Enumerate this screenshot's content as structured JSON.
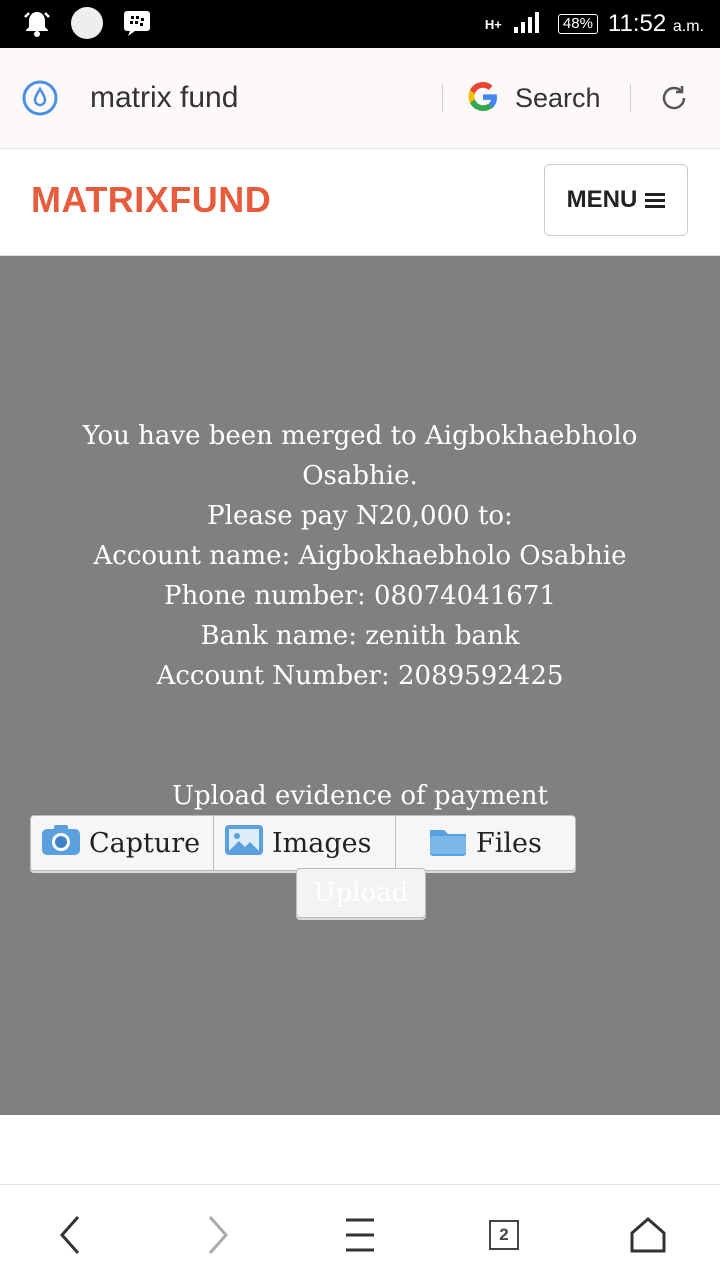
{
  "status_bar": {
    "network": "H+",
    "battery": "48%",
    "time": "11:52",
    "ampm": "a.m."
  },
  "browser": {
    "url_text": "matrix fund",
    "search_label": "Search"
  },
  "site": {
    "brand": "MATRIXFUND",
    "menu_label": "MENU",
    "brand_color": "#e65c3c"
  },
  "modal": {
    "lines": [
      "You have been merged to Aigbokhaebholo Osabhie.",
      "Please pay N20,000 to:",
      "Account name: Aigbokhaebholo Osabhie",
      "Phone number: 08074041671",
      "Bank name: zenith bank",
      "Account Number: 2089592425"
    ],
    "upload_label": "Upload evidence of payment",
    "picker": [
      "Capture",
      "Images",
      "Files"
    ],
    "upload_button": "Upload"
  },
  "nav": {
    "tab_count": "2"
  }
}
